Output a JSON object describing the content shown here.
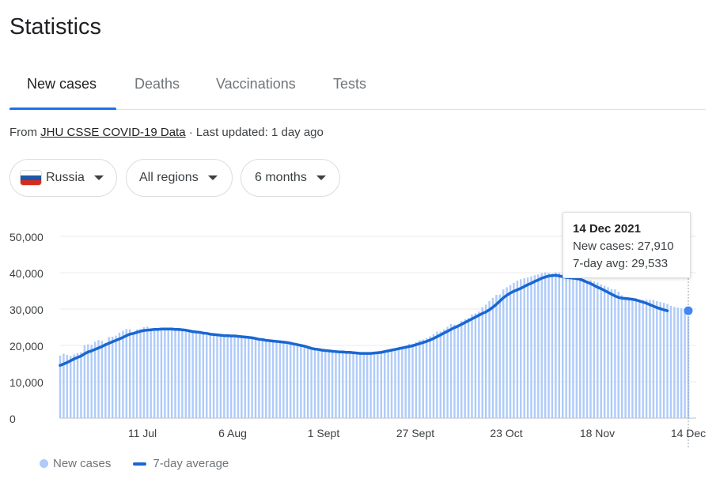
{
  "page": {
    "title": "Statistics"
  },
  "tabs": [
    {
      "label": "New cases",
      "active": true
    },
    {
      "label": "Deaths",
      "active": false
    },
    {
      "label": "Vaccinations",
      "active": false
    },
    {
      "label": "Tests",
      "active": false
    }
  ],
  "source": {
    "prefix": "From ",
    "link_text": "JHU CSSE COVID-19 Data",
    "suffix": " · Last updated: 1 day ago"
  },
  "filters": {
    "country": "Russia",
    "region": "All regions",
    "range": "6 months"
  },
  "tooltip": {
    "date": "14 Dec 2021",
    "new_cases_label": "New cases: 27,910",
    "avg_label": "7-day avg: 29,533"
  },
  "legend": {
    "bars_label": "New cases",
    "line_label": "7-day average"
  },
  "colors": {
    "bar": "#aecbfa",
    "line": "#1967d2",
    "tab_accent": "#1a73e8",
    "flag_white": "#ffffff",
    "flag_blue": "#1c57a7",
    "flag_red": "#d52b1e"
  },
  "chart_data": {
    "type": "bar",
    "title": "",
    "xlabel": "",
    "ylabel": "",
    "ylim": [
      0,
      50000
    ],
    "yticks": [
      0,
      10000,
      20000,
      30000,
      40000,
      50000
    ],
    "ytick_labels": [
      "0",
      "10,000",
      "20,000",
      "30,000",
      "40,000",
      "50,000"
    ],
    "xtick_labels": [
      "11 Jul",
      "6 Aug",
      "1 Sept",
      "27 Sept",
      "23 Oct",
      "18 Nov",
      "14 Dec"
    ],
    "x_start": "16 Jun 2021",
    "x_end": "14 Dec 2021",
    "series": [
      {
        "name": "New cases",
        "kind": "bar",
        "values": [
          17200,
          17700,
          17400,
          17100,
          17500,
          17900,
          18100,
          20100,
          20300,
          20200,
          21000,
          21500,
          21300,
          20700,
          22300,
          22400,
          22700,
          23500,
          24000,
          24500,
          24400,
          23600,
          24400,
          24500,
          25000,
          25200,
          24400,
          24600,
          24800,
          24500,
          24300,
          24200,
          24500,
          24300,
          24100,
          24500,
          24200,
          23900,
          24000,
          23400,
          23200,
          23000,
          22800,
          22900,
          22800,
          23000,
          22600,
          22500,
          22700,
          22500,
          22200,
          22100,
          22100,
          22200,
          22100,
          21900,
          21800,
          21500,
          21600,
          21300,
          21000,
          20900,
          20900,
          21000,
          20800,
          20400,
          20200,
          20200,
          20100,
          20100,
          19800,
          19200,
          18900,
          18800,
          18800,
          18600,
          18500,
          18400,
          18200,
          18000,
          17800,
          17900,
          18000,
          17900,
          17800,
          17600,
          17600,
          17600,
          17600,
          17900,
          18100,
          18000,
          18400,
          18700,
          18700,
          18600,
          19000,
          19100,
          19300,
          19800,
          20400,
          20400,
          20900,
          21400,
          21600,
          22000,
          22500,
          23100,
          23800,
          23800,
          24400,
          25100,
          25900,
          25700,
          25800,
          26700,
          27200,
          27500,
          28500,
          28800,
          29300,
          30500,
          31200,
          32200,
          33100,
          33900,
          34000,
          35400,
          36000,
          36600,
          37200,
          37800,
          38200,
          38500,
          38700,
          39000,
          39300,
          39500,
          39900,
          40100,
          40000,
          39800,
          40100,
          40000,
          39700,
          39400,
          39200,
          38900,
          38600,
          38300,
          38300,
          37800,
          37900,
          37600,
          37300,
          36800,
          36400,
          36000,
          35500,
          35400,
          34800,
          33800,
          33300,
          33200,
          33000,
          32900,
          32700,
          32600,
          32600,
          32500,
          32500,
          32200,
          31900,
          31700,
          31400,
          30900,
          30600,
          30400,
          30200,
          29900,
          27910
        ]
      },
      {
        "name": "7-day average",
        "kind": "line",
        "values": [
          14500,
          14900,
          15300,
          15800,
          16300,
          16700,
          17100,
          17700,
          18200,
          18500,
          18900,
          19300,
          19700,
          20200,
          20600,
          21000,
          21400,
          21800,
          22200,
          22700,
          23100,
          23300,
          23600,
          23900,
          24100,
          24200,
          24300,
          24400,
          24400,
          24500,
          24500,
          24500,
          24500,
          24400,
          24400,
          24300,
          24200,
          24000,
          23800,
          23700,
          23600,
          23400,
          23300,
          23100,
          23000,
          22900,
          22800,
          22700,
          22700,
          22600,
          22600,
          22500,
          22400,
          22300,
          22200,
          22100,
          21900,
          21700,
          21600,
          21400,
          21300,
          21200,
          21100,
          21000,
          20900,
          20800,
          20600,
          20400,
          20200,
          20000,
          19800,
          19500,
          19200,
          19000,
          18900,
          18700,
          18600,
          18500,
          18400,
          18300,
          18200,
          18200,
          18100,
          18100,
          18000,
          17900,
          17800,
          17800,
          17800,
          17800,
          17900,
          18000,
          18100,
          18300,
          18500,
          18700,
          18900,
          19100,
          19300,
          19500,
          19700,
          19900,
          20200,
          20500,
          20800,
          21100,
          21500,
          21900,
          22400,
          22900,
          23400,
          23900,
          24400,
          24900,
          25300,
          25800,
          26300,
          26800,
          27300,
          27800,
          28300,
          28800,
          29200,
          29800,
          30500,
          31300,
          32200,
          33100,
          33800,
          34400,
          34900,
          35300,
          35700,
          36200,
          36700,
          37100,
          37600,
          38000,
          38500,
          38800,
          39100,
          39200,
          39300,
          39100,
          38900,
          38700,
          38600,
          38500,
          38400,
          38200,
          37800,
          37400,
          37000,
          36500,
          36000,
          35600,
          35100,
          34600,
          34100,
          33600,
          33200,
          33000,
          32900,
          32800,
          32700,
          32500,
          32200,
          31900,
          31600,
          31200,
          30800,
          30400,
          30100,
          29800,
          29533
        ]
      }
    ],
    "highlight": {
      "date": "14 Dec 2021",
      "new_cases": 27910,
      "avg": 29533
    },
    "grid": true,
    "legend_position": "bottom-left"
  }
}
